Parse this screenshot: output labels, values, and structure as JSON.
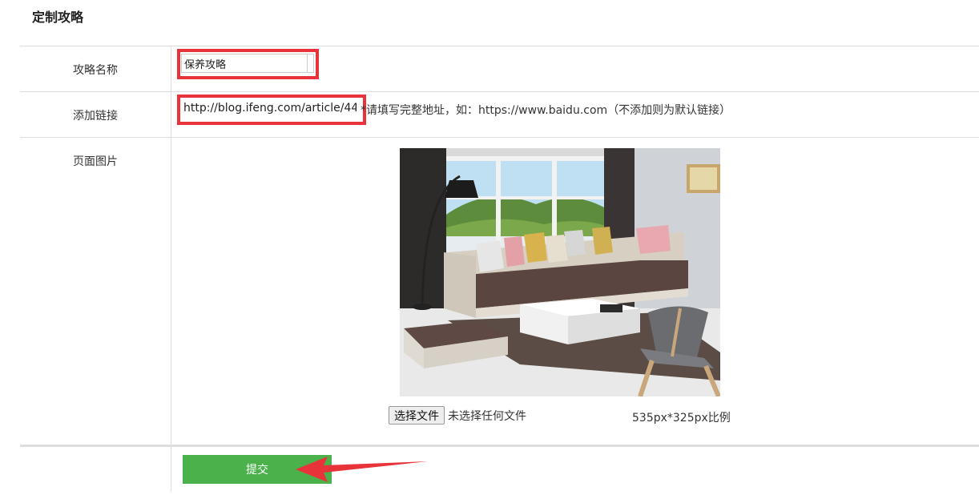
{
  "page": {
    "title": "定制攻略"
  },
  "form": {
    "name_label": "攻略名称",
    "name_value": "保养攻略",
    "link_label": "添加链接",
    "link_value": "http://blog.ifeng.com/article/44",
    "link_hint": "*请填写完整地址，如：https://www.baidu.com（不添加则为默认链接）",
    "image_label": "页面图片",
    "file_button_label": "选择文件",
    "file_status": "未选择任何文件",
    "image_ratio": "535px*325px比例",
    "submit_label": "提交"
  },
  "colors": {
    "highlight": "#e8333a",
    "submit_bg": "#4bb24b",
    "divider": "#dddddd"
  }
}
